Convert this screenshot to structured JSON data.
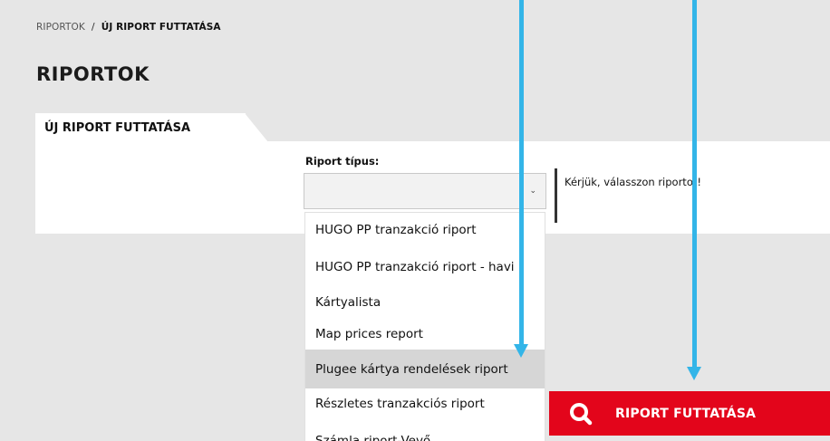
{
  "breadcrumb": {
    "parent": "RIPORTOK",
    "separator": "/",
    "current": "ÚJ RIPORT FUTTATÁSA"
  },
  "page": {
    "title": "RIPORTOK"
  },
  "tab": {
    "label": "ÚJ RIPORT FUTTATÁSA"
  },
  "form": {
    "report_type_label": "Riport típus:",
    "selected_value": "",
    "help_text": "Kérjük, válasszon riportot!"
  },
  "dropdown": {
    "items": [
      "HUGO PP tranzakció riport",
      "HUGO PP tranzakció riport - havi",
      "Kártyalista",
      "Map prices report",
      "Plugee kártya rendelések riport",
      "Részletes tranzakciós riport",
      "Számla riport-Vevő"
    ],
    "highlighted_index": 4
  },
  "run_button": {
    "label": "RIPORT FUTTATÁSA",
    "icon": "search-icon"
  },
  "colors": {
    "accent": "#e3051b",
    "annotation_arrow": "#33b5e8"
  }
}
